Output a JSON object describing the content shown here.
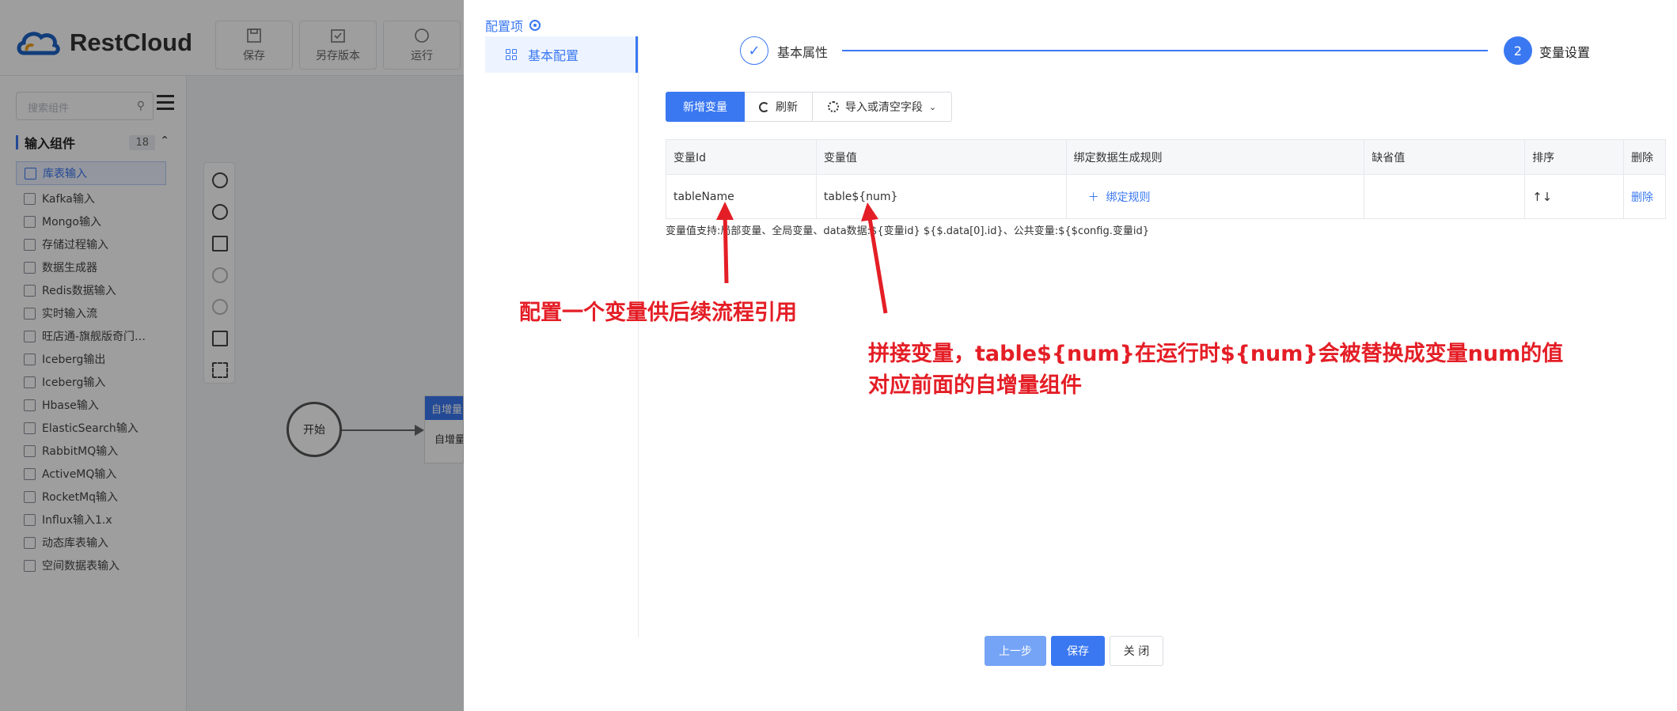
{
  "app": {
    "brand": "RestCloud",
    "toolbar": [
      {
        "label": "保存",
        "icon": "save-icon"
      },
      {
        "label": "另存版本",
        "icon": "save-version-icon"
      },
      {
        "label": "运行",
        "icon": "run-icon"
      }
    ],
    "search_placeholder": "搜索组件",
    "group": {
      "title": "输入组件",
      "count": "18"
    },
    "components": [
      "库表输入",
      "Kafka输入",
      "Mongo输入",
      "存储过程输入",
      "数据生成器",
      "Redis数据输入",
      "实时输入流",
      "旺店通-旗舰版奇门…",
      "Iceberg输出",
      "Iceberg输入",
      "Hbase输入",
      "ElasticSearch输入",
      "RabbitMQ输入",
      "ActiveMQ输入",
      "RocketMq输入",
      "Influx输入1.x",
      "动态库表输入",
      "空间数据表输入"
    ],
    "canvas": {
      "start_label": "开始",
      "next_node_header": "自增量",
      "next_node_body": "自增量"
    }
  },
  "drawer": {
    "config_title": "配置项",
    "nav_item": "基本配置",
    "steps": {
      "step1_label": "基本属性",
      "step2_number": "2",
      "step2_label": "变量设置"
    },
    "buttons": {
      "add": "新增变量",
      "refresh": "刷新",
      "import": "导入或清空字段"
    },
    "table": {
      "headers": [
        "变量Id",
        "变量值",
        "绑定数据生成规则",
        "缺省值",
        "排序",
        "删除"
      ],
      "rows": [
        {
          "id": "tableName",
          "value": "table${num}",
          "rule": "绑定规则",
          "default": "",
          "sort": "↑↓",
          "delete": "删除"
        }
      ]
    },
    "hint": "变量值支持:局部变量、全局变量、data数据:${变量id} ${$.data[0].id}、公共变量:${$config.变量id}",
    "annotations": {
      "a1": "配置一个变量供后续流程引用",
      "a2_line1": "拼接变量，table${num}在运行时${num}会被替换成变量num的值",
      "a2_line2": "对应前面的自增量组件"
    },
    "footer": {
      "prev": "上一步",
      "save": "保存",
      "close": "关 闭"
    }
  },
  "colors": {
    "accent": "#3a78f2",
    "annotation": "#e41e26"
  }
}
